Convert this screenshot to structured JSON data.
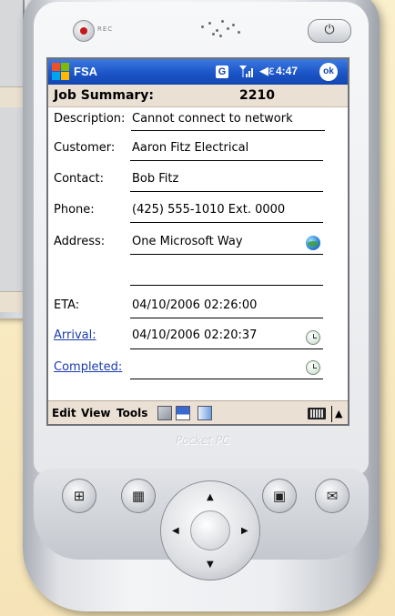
{
  "device": {
    "rec_label": "REC",
    "brand_label": "Pocket PC",
    "power_glyph": "⏻"
  },
  "titlebar": {
    "app_title": "FSA",
    "g_label": "G",
    "time": "4:47",
    "ok_label": "ok"
  },
  "summary": {
    "label": "Job Summary:",
    "value": "2210"
  },
  "fields": {
    "description": {
      "label": "Description:",
      "value": "Cannot connect to network"
    },
    "customer": {
      "label": "Customer:",
      "value": "Aaron Fitz Electrical"
    },
    "contact": {
      "label": "Contact:",
      "value": "Bob Fitz"
    },
    "phone": {
      "label": "Phone:",
      "value": "(425) 555-1010 Ext. 0000"
    },
    "address": {
      "label": "Address:",
      "value": "One Microsoft Way"
    },
    "eta": {
      "label": "ETA:",
      "value": "04/10/2006 02:26:00"
    },
    "arrival": {
      "label": "Arrival:",
      "value": "04/10/2006 02:20:37"
    },
    "completed": {
      "label": "Completed:",
      "value": ""
    }
  },
  "menubar": {
    "edit": "Edit",
    "view": "View",
    "tools": "Tools"
  },
  "icons": {
    "status": [
      "signal-icon",
      "speaker-icon"
    ],
    "toolbar": [
      "export-icon",
      "save-icon",
      "send-icon",
      "keyboard-icon"
    ],
    "hardware": [
      "windows-button-icon",
      "calendar-button-icon",
      "contacts-button-icon",
      "inbox-button-icon"
    ]
  },
  "colors": {
    "titlebar": "#1b55c8",
    "summary_bg": "#ebe0d4",
    "link": "#1a3bb0",
    "background": "#f6e4b8"
  }
}
